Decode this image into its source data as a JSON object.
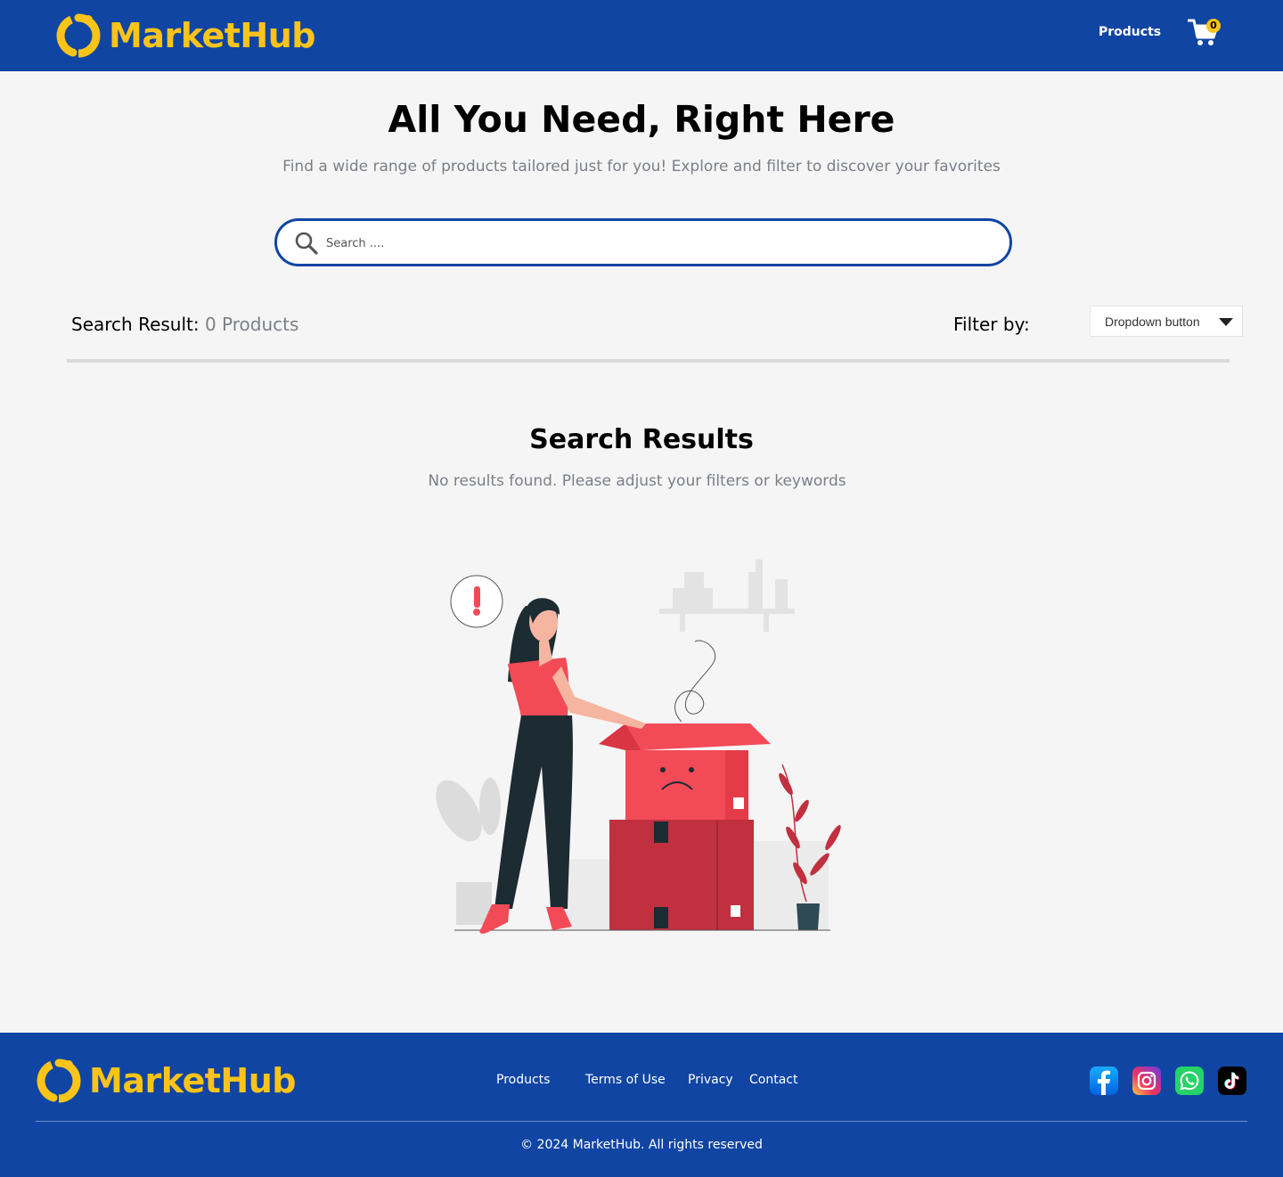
{
  "header": {
    "brand": "MarketHub",
    "nav_products": "Products",
    "cart_count": "0"
  },
  "hero": {
    "title": "All You Need, Right Here",
    "subtitle": "Find a wide range of products tailored just for you! Explore and filter to discover your favorites"
  },
  "search": {
    "placeholder": "Search ....",
    "value": ""
  },
  "results_bar": {
    "label": "Search Result:",
    "count": "0 Products",
    "filter_label": "Filter by:",
    "dropdown_label": "Dropdown button"
  },
  "empty_state": {
    "title": "Search Results",
    "message": "No results found. Please adjust your filters or keywords"
  },
  "footer": {
    "brand": "MarketHub",
    "links": [
      "Products",
      "Terms of Use",
      "Privacy",
      "Contact"
    ],
    "social": [
      "facebook-icon",
      "instagram-icon",
      "whatsapp-icon",
      "tiktok-icon"
    ],
    "copyright": "© 2024 MarketHub. All rights reserved"
  },
  "colors": {
    "primary": "#1045a3",
    "accent": "#fcc419",
    "muted_text": "#7b7f86",
    "illustration_red": "#f24b57"
  }
}
